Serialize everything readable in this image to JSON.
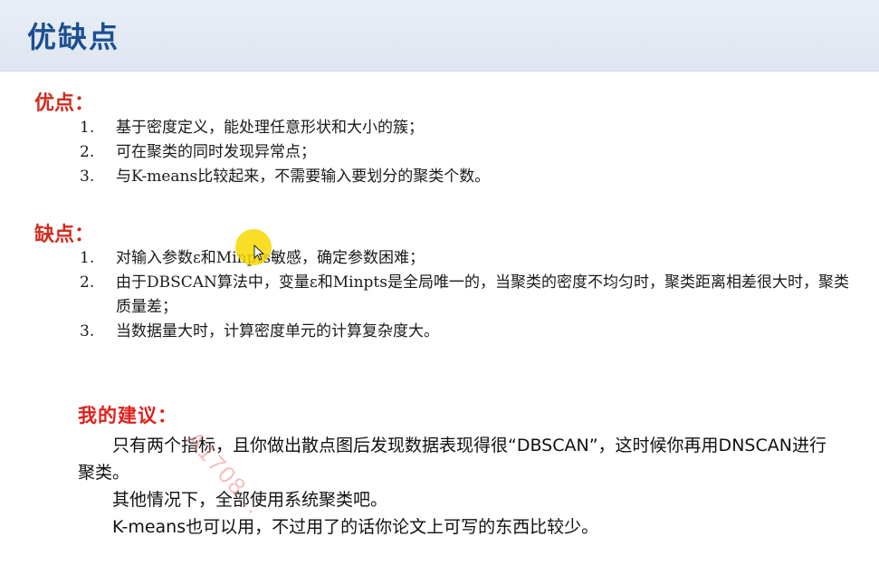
{
  "header": {
    "title": "优缺点"
  },
  "pros": {
    "heading": "优点：",
    "items": [
      {
        "num": "1.",
        "text": "基于密度定义，能处理任意形状和大小的簇；"
      },
      {
        "num": "2.",
        "text": "可在聚类的同时发现异常点；"
      },
      {
        "num": "3.",
        "text": "与K-means比较起来，不需要输入要划分的聚类个数。"
      }
    ]
  },
  "cons": {
    "heading": "缺点：",
    "items": [
      {
        "num": "1.",
        "text": "对输入参数ε和Minpts敏感，确定参数困难；"
      },
      {
        "num": "2.",
        "text": "由于DBSCAN算法中，变量ε和Minpts是全局唯一的，当聚类的密度不均匀时，聚类距离相差很大时，聚类质量差；"
      },
      {
        "num": "3.",
        "text": "当数据量大时，计算密度单元的计算复杂度大。"
      }
    ]
  },
  "advice": {
    "heading": "我的建议：",
    "para1": "　　只有两个指标，且你做出散点图后发现数据表现得很“DBSCAN”，这时候你再用DNSCAN进行聚类。",
    "para2": "　　其他情况下，全部使用系统聚类吧。",
    "para3": "　　K-means也可以用，不过用了的话你论文上可写的东西比较少。"
  },
  "watermark": {
    "text": "A1708..."
  }
}
